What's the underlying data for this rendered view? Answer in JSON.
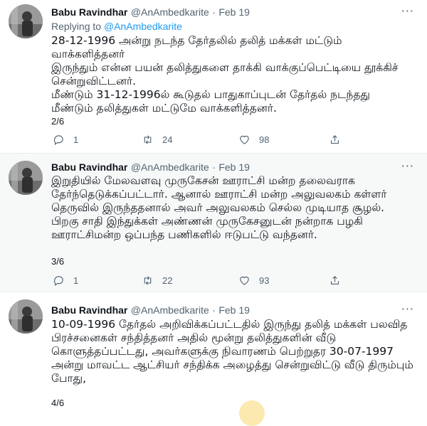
{
  "tweets": [
    {
      "name": "Babu Ravindhar",
      "handle": "@AnAmbedkarite",
      "date": "Feb 19",
      "replying_prefix": "Replying to",
      "replying_to": "@AnAmbedkarite",
      "text": "28-12-1996 அன்று நடந்த தேர்தலில் தலித் மக்கள் மட்டும் வாக்களித்தனர்\nஇருந்தும் என்ன பயன் தலித்துகளை தாக்கி வாக்குப்பெட்டியை தூக்கிச் சென்றுவிட்டனர்.\nமீண்டும் 31-12-1996ல் கூடுதல் பாதுகாப்புடன் தேர்தல் நடந்தது  மீண்டும் தலித்துகள் மட்டுமே வாக்களித்தனர்.",
      "counter": "2/6",
      "retweets": "24",
      "likes": "98"
    },
    {
      "name": "Babu Ravindhar",
      "handle": "@AnAmbedkarite",
      "date": "Feb 19",
      "text": "இறுதியில் மேலவளவு முருகேசன் ஊராட்சி மன்ற தலைவராக தேர்ந்தெடுக்கப்பட்டார். ஆனால் ஊராட்சி மன்ற அலுவலகம் கள்ளர் தெருவில் இருந்ததனால் அவர் அலுவலகம் செல்ல முடியாத சூழல். பிறகு சாதி இந்துக்கள் அண்ணன் முருகேசனுடன் நன்றாக பழகி ஊராட்சிமன்ற ஒப்பந்த பணிகளில் ஈடுபட்டு வந்தனர்.",
      "counter": "3/6",
      "retweets": "22",
      "likes": "93"
    },
    {
      "name": "Babu Ravindhar",
      "handle": "@AnAmbedkarite",
      "date": "Feb 19",
      "text": "10-09-1996 தேர்தல் அறிவிக்கப்பட்டதில் இருந்து தலித் மக்கள் பலவித பிரச்சனைகள் சந்தித்தனர் அதில் மூன்று தலித்துகளின் வீடு கொளுத்தப்பட்டது, அவர்களுக்கு நிவாரணம் பெற்றுதர 30-07-1997 அன்று மாவட்ட ஆட்சியர் சந்திக்க அழைத்து சென்றுவிட்டு வீடு திரும்பும் போது,",
      "counter": "4/6"
    }
  ],
  "colors": {
    "link": "#1d9bf0",
    "muted": "#536471",
    "text": "#0f1419"
  },
  "icons": {
    "reply": "reply-icon",
    "retweet": "retweet-icon",
    "like": "heart-icon",
    "more": "more-icon"
  }
}
